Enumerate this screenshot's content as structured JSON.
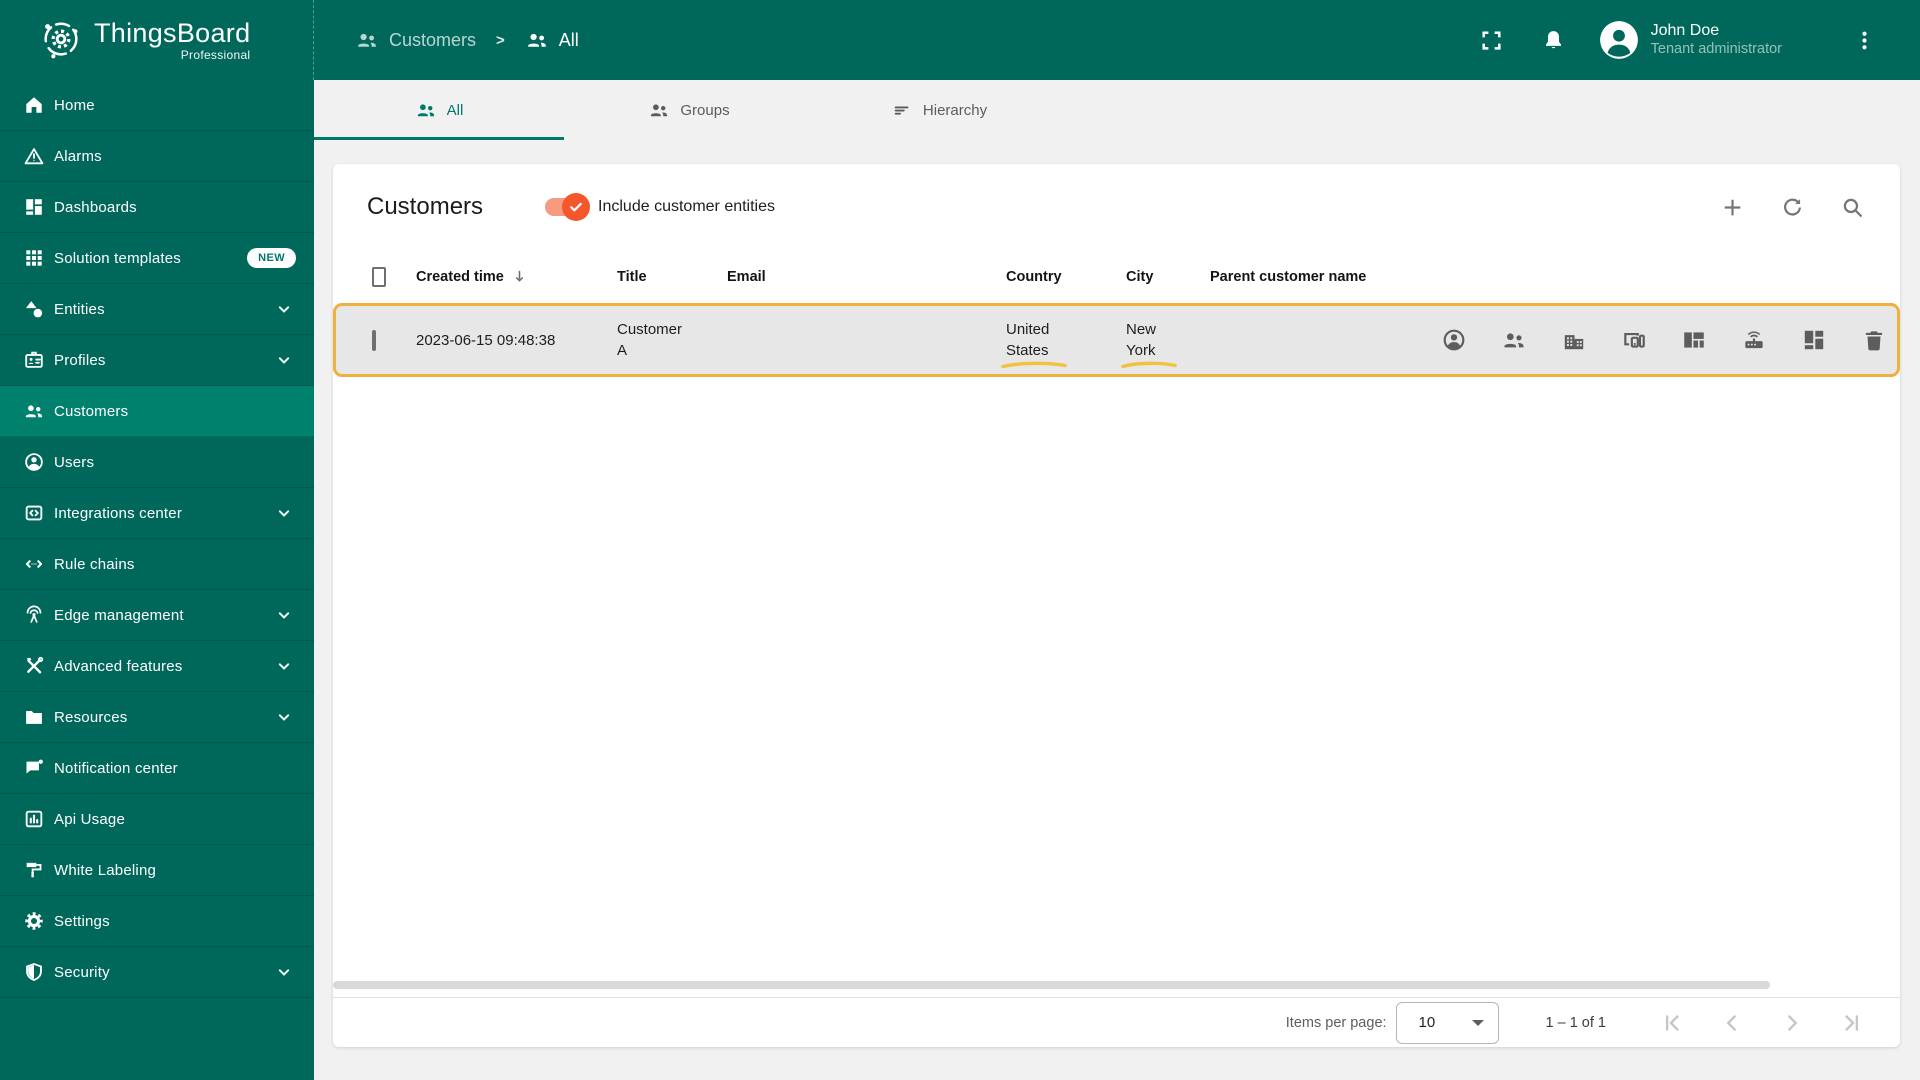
{
  "app": {
    "brand": "ThingsBoard",
    "brand_sub": "Professional"
  },
  "header": {
    "breadcrumb": {
      "root": "Customers",
      "separator": ">",
      "current": "All"
    },
    "user": {
      "name": "John Doe",
      "role": "Tenant administrator"
    },
    "icons": [
      "fullscreen-icon",
      "notifications-bell-icon",
      "avatar",
      "kebab-menu-icon"
    ]
  },
  "sidebar": {
    "items": [
      {
        "label": "Home",
        "icon": "home-icon"
      },
      {
        "label": "Alarms",
        "icon": "warning-icon"
      },
      {
        "label": "Dashboards",
        "icon": "dashboard-icon"
      },
      {
        "label": "Solution templates",
        "icon": "apps-grid-icon",
        "badge": "NEW"
      },
      {
        "label": "Entities",
        "icon": "category-icon",
        "chevron": true
      },
      {
        "label": "Profiles",
        "icon": "badge-icon",
        "chevron": true
      },
      {
        "label": "Customers",
        "icon": "people-icon",
        "active": true
      },
      {
        "label": "Users",
        "icon": "account-circle-icon"
      },
      {
        "label": "Integrations center",
        "icon": "integration-icon",
        "chevron": true
      },
      {
        "label": "Rule chains",
        "icon": "rule-chain-icon"
      },
      {
        "label": "Edge management",
        "icon": "antenna-icon",
        "chevron": true
      },
      {
        "label": "Advanced features",
        "icon": "tools-icon",
        "chevron": true
      },
      {
        "label": "Resources",
        "icon": "folder-icon",
        "chevron": true
      },
      {
        "label": "Notification center",
        "icon": "notification-icon"
      },
      {
        "label": "Api Usage",
        "icon": "chart-box-icon"
      },
      {
        "label": "White Labeling",
        "icon": "paint-roller-icon"
      },
      {
        "label": "Settings",
        "icon": "gear-icon"
      },
      {
        "label": "Security",
        "icon": "shield-icon",
        "chevron": true
      }
    ]
  },
  "tabs": [
    {
      "label": "All",
      "icon": "people-icon",
      "active": true
    },
    {
      "label": "Groups",
      "icon": "people-icon"
    },
    {
      "label": "Hierarchy",
      "icon": "hierarchy-icon"
    }
  ],
  "panel": {
    "title": "Customers",
    "toggle_label": "Include customer entities",
    "toggle_on": true,
    "header_actions": [
      "add-icon",
      "refresh-icon",
      "search-icon"
    ]
  },
  "table": {
    "columns": {
      "created": "Created time",
      "title": "Title",
      "email": "Email",
      "country": "Country",
      "city": "City",
      "parent": "Parent customer name"
    },
    "sort": {
      "column": "Created time",
      "direction": "desc"
    },
    "rows": [
      {
        "created_time": "2023-06-15 09:48:38",
        "title": "Customer A",
        "email": "",
        "country": "United States",
        "city": "New York",
        "parent": "",
        "highlighted": true,
        "actions": [
          "manage-users-icon",
          "manage-customers-icon",
          "manage-assets-icon",
          "manage-devices-icon",
          "manage-dashboards-icon",
          "manage-edges-icon",
          "manage-widgets-icon",
          "delete-icon"
        ]
      }
    ]
  },
  "paginator": {
    "items_per_page_label": "Items per page:",
    "items_per_page": "10",
    "range": "1 – 1 of 1",
    "nav": [
      "first-page-icon",
      "prev-page-icon",
      "next-page-icon",
      "last-page-icon"
    ]
  },
  "colors": {
    "topbar": "#00685b",
    "sidebar_active": "#00816e",
    "accent": "#00786b",
    "toggle_on": "#f4572b",
    "toggle_track": "#f79b80",
    "row_highlight_border": "#efb13d",
    "marker_underline": "#f2c13e",
    "row_bg": "#e7e7e7"
  }
}
